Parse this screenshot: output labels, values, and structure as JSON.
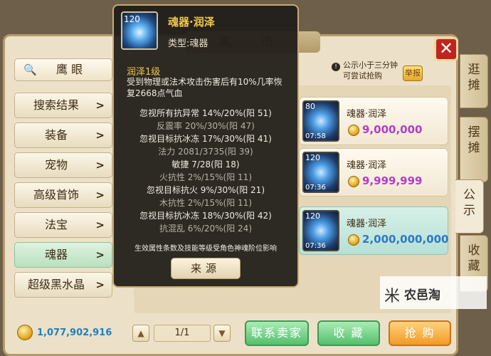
{
  "window": {
    "title": "集 市"
  },
  "search": {
    "label": "鹰 眼",
    "icon": "search-icon"
  },
  "categories": [
    {
      "label": "搜索结果",
      "selected": false
    },
    {
      "label": "装备",
      "selected": false
    },
    {
      "label": "宠物",
      "selected": false
    },
    {
      "label": "高级首饰",
      "selected": false
    },
    {
      "label": "法宝",
      "selected": false
    },
    {
      "label": "魂器",
      "selected": true
    },
    {
      "label": "超级黑水晶",
      "selected": false
    }
  ],
  "arrow_glyph": ">",
  "side_tabs": [
    {
      "label": "逛摊",
      "active": false
    },
    {
      "label": "摆摊",
      "active": false
    },
    {
      "label": "公示",
      "active": true
    },
    {
      "label": "收藏",
      "active": false
    }
  ],
  "notice": {
    "text": "公示小于三分钟可尝试抢购",
    "report_label": "举报"
  },
  "items": [
    {
      "level": "80",
      "time": "07:58",
      "name": "魂器·润泽",
      "price": "9,000,000",
      "price_color": "#b43dc8",
      "selected": false
    },
    {
      "level": "120",
      "time": "07:36",
      "name": "魂器·润泽",
      "price": "9,999,999",
      "price_color": "#b43dc8",
      "selected": false
    },
    {
      "level": "120",
      "time": "07:36",
      "name": "魂器·润泽",
      "price": "2,000,000,000",
      "price_color": "#2d78c8",
      "selected": true
    }
  ],
  "tooltip": {
    "level": "120",
    "name": "魂器·润泽",
    "type_label": "类型:魂器",
    "subtitle": "润泽1级",
    "desc": "受到物理或法术攻击伤害后有10%几率恢复2668点气血",
    "stats": [
      {
        "text": "忽视所有抗异常 14%/20%(阳 51)",
        "color": "#f1ece0"
      },
      {
        "text": "反震率 20%/30%(阳 47)",
        "color": "#b8b2a4"
      },
      {
        "text": "忽视目标抗冰冻 17%/30%(阳 41)",
        "color": "#f1ece0"
      },
      {
        "text": "法力 2081/3735(阳 39)",
        "color": "#b8b2a4"
      },
      {
        "text": "敏捷 7/28(阳 18)",
        "color": "#f1ece0"
      },
      {
        "text": "火抗性 2%/15%(阳 11)",
        "color": "#b8b2a4"
      },
      {
        "text": "忽视目标抗火 9%/30%(阳 21)",
        "color": "#f1ece0"
      },
      {
        "text": "木抗性 2%/15%(阳 11)",
        "color": "#b8b2a4"
      },
      {
        "text": "忽视目标抗冰冻 18%/30%(阳 42)",
        "color": "#f1ece0"
      },
      {
        "text": "抗混乱 6%/20%(阳 24)",
        "color": "#b8b2a4"
      }
    ],
    "footer": "生效属性条数及技能等级受角色神魂阶位影响",
    "source_label": "来源"
  },
  "footer": {
    "gold": "1,077,902,916",
    "page": "1/1",
    "contact_label": "联系卖家",
    "favorite_label": "收 藏",
    "buy_label": "抢 购"
  },
  "watermark": {
    "text": "农邑淘",
    "icon": "logo-icon"
  },
  "colors": {
    "gold_text": "#f2c84b",
    "frame": "#ece1c8",
    "tooltip_bg": "#211e19"
  }
}
